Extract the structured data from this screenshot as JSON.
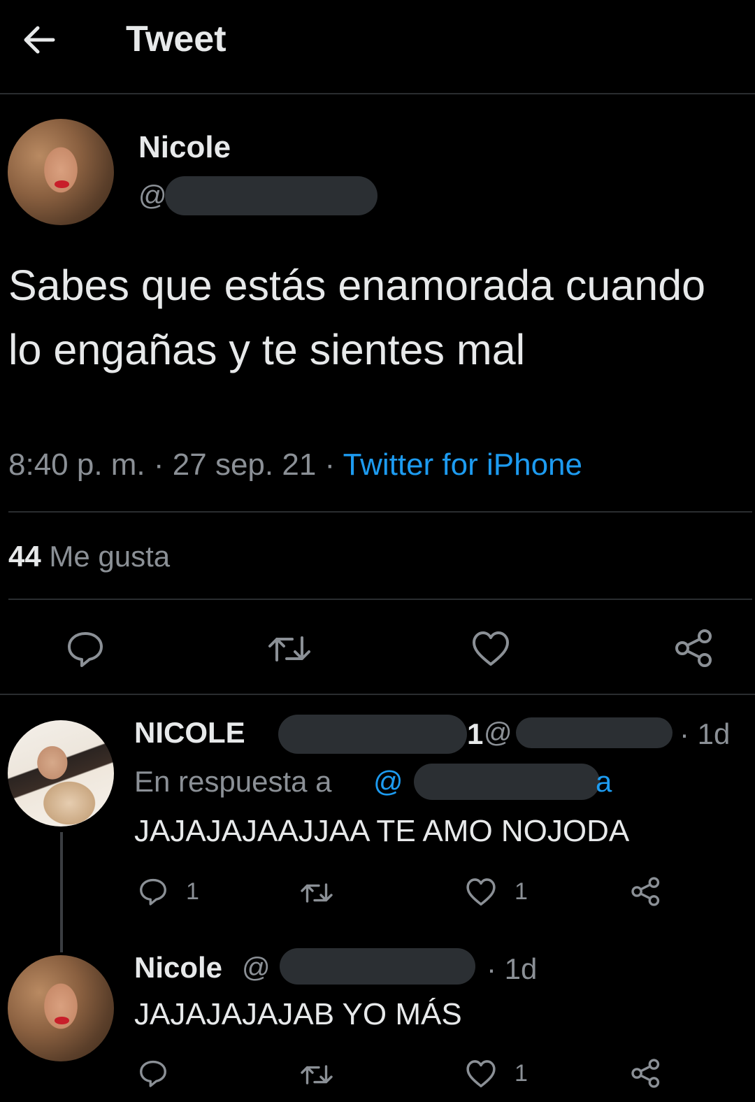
{
  "header": {
    "title": "Tweet"
  },
  "tweet": {
    "author": {
      "name": "Nicole",
      "handle_prefix": "@"
    },
    "text": "Sabes que estás enamorada cuando lo engañas y te sientes mal",
    "time": "8:40 p. m.",
    "sep1": "·",
    "date": "27 sep. 21",
    "sep2": "·",
    "source": "Twitter for iPhone",
    "likes_count": "44",
    "likes_label": "Me gusta"
  },
  "replies": [
    {
      "name_prefix": "NICOLE",
      "handle_prefix": "@",
      "age": "· 1d",
      "reply_to_label": "En respuesta a",
      "reply_to_handle_prefix": "@",
      "text": "JAJAJAJAAJJAA TE AMO NOJODA",
      "reply_count": "1",
      "like_count": "1"
    },
    {
      "name": "Nicole",
      "handle_prefix": "@",
      "age": "· 1d",
      "text": "JAJAJAJAJAB YO MÁS",
      "like_count": "1"
    }
  ],
  "colors": {
    "background": "#000000",
    "accent": "#1d9bf0",
    "text": "#e7e9ea",
    "muted": "#8b9096"
  },
  "icons": [
    "back-arrow-icon",
    "reply-icon",
    "retweet-icon",
    "like-icon",
    "share-icon"
  ]
}
